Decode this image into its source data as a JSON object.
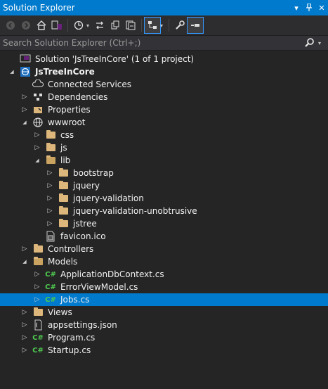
{
  "window": {
    "title": "Solution Explorer"
  },
  "search": {
    "placeholder": "Search Solution Explorer (Ctrl+;)"
  },
  "tree": [
    {
      "label": "Solution 'JsTreeInCore' (1 of 1 project)",
      "level": 0,
      "arrow": "",
      "icon": "solution-icon",
      "bold": false
    },
    {
      "label": "JsTreeInCore",
      "level": 0,
      "arrow": "expanded",
      "icon": "web-project-icon",
      "bold": true
    },
    {
      "label": "Connected Services",
      "level": 1,
      "arrow": "",
      "icon": "connected-services-icon",
      "bold": false
    },
    {
      "label": "Dependencies",
      "level": 1,
      "arrow": "collapsed",
      "icon": "dependencies-icon",
      "bold": false
    },
    {
      "label": "Properties",
      "level": 1,
      "arrow": "collapsed",
      "icon": "properties-icon",
      "bold": false
    },
    {
      "label": "wwwroot",
      "level": 1,
      "arrow": "expanded",
      "icon": "globe-icon",
      "bold": false
    },
    {
      "label": "css",
      "level": 2,
      "arrow": "collapsed",
      "icon": "folder-icon",
      "bold": false
    },
    {
      "label": "js",
      "level": 2,
      "arrow": "collapsed",
      "icon": "folder-icon",
      "bold": false
    },
    {
      "label": "lib",
      "level": 2,
      "arrow": "expanded",
      "icon": "folder-open-icon",
      "bold": false
    },
    {
      "label": "bootstrap",
      "level": 3,
      "arrow": "collapsed",
      "icon": "folder-icon",
      "bold": false
    },
    {
      "label": "jquery",
      "level": 3,
      "arrow": "collapsed",
      "icon": "folder-icon",
      "bold": false
    },
    {
      "label": "jquery-validation",
      "level": 3,
      "arrow": "collapsed",
      "icon": "folder-icon",
      "bold": false
    },
    {
      "label": "jquery-validation-unobtrusive",
      "level": 3,
      "arrow": "collapsed",
      "icon": "folder-icon",
      "bold": false
    },
    {
      "label": "jstree",
      "level": 3,
      "arrow": "collapsed",
      "icon": "folder-icon",
      "bold": false
    },
    {
      "label": "favicon.ico",
      "level": 2,
      "arrow": "",
      "icon": "ico-file-icon",
      "bold": false
    },
    {
      "label": "Controllers",
      "level": 1,
      "arrow": "collapsed",
      "icon": "folder-icon",
      "bold": false
    },
    {
      "label": "Models",
      "level": 1,
      "arrow": "expanded",
      "icon": "folder-open-icon",
      "bold": false
    },
    {
      "label": "ApplicationDbContext.cs",
      "level": 2,
      "arrow": "collapsed",
      "icon": "csharp-file-icon",
      "bold": false
    },
    {
      "label": "ErrorViewModel.cs",
      "level": 2,
      "arrow": "collapsed",
      "icon": "csharp-file-icon",
      "bold": false
    },
    {
      "label": "Jobs.cs",
      "level": 2,
      "arrow": "collapsed",
      "icon": "csharp-file-icon",
      "bold": false,
      "selected": true
    },
    {
      "label": "Views",
      "level": 1,
      "arrow": "collapsed",
      "icon": "folder-icon",
      "bold": false
    },
    {
      "label": "appsettings.json",
      "level": 1,
      "arrow": "collapsed",
      "icon": "json-file-icon",
      "bold": false
    },
    {
      "label": "Program.cs",
      "level": 1,
      "arrow": "collapsed",
      "icon": "csharp-file-icon",
      "bold": false
    },
    {
      "label": "Startup.cs",
      "level": 1,
      "arrow": "collapsed",
      "icon": "csharp-file-icon",
      "bold": false
    }
  ],
  "colors": {
    "accent": "#007acc",
    "background": "#252526",
    "folder": "#dcb67a",
    "csharp": "#4ec94e"
  }
}
